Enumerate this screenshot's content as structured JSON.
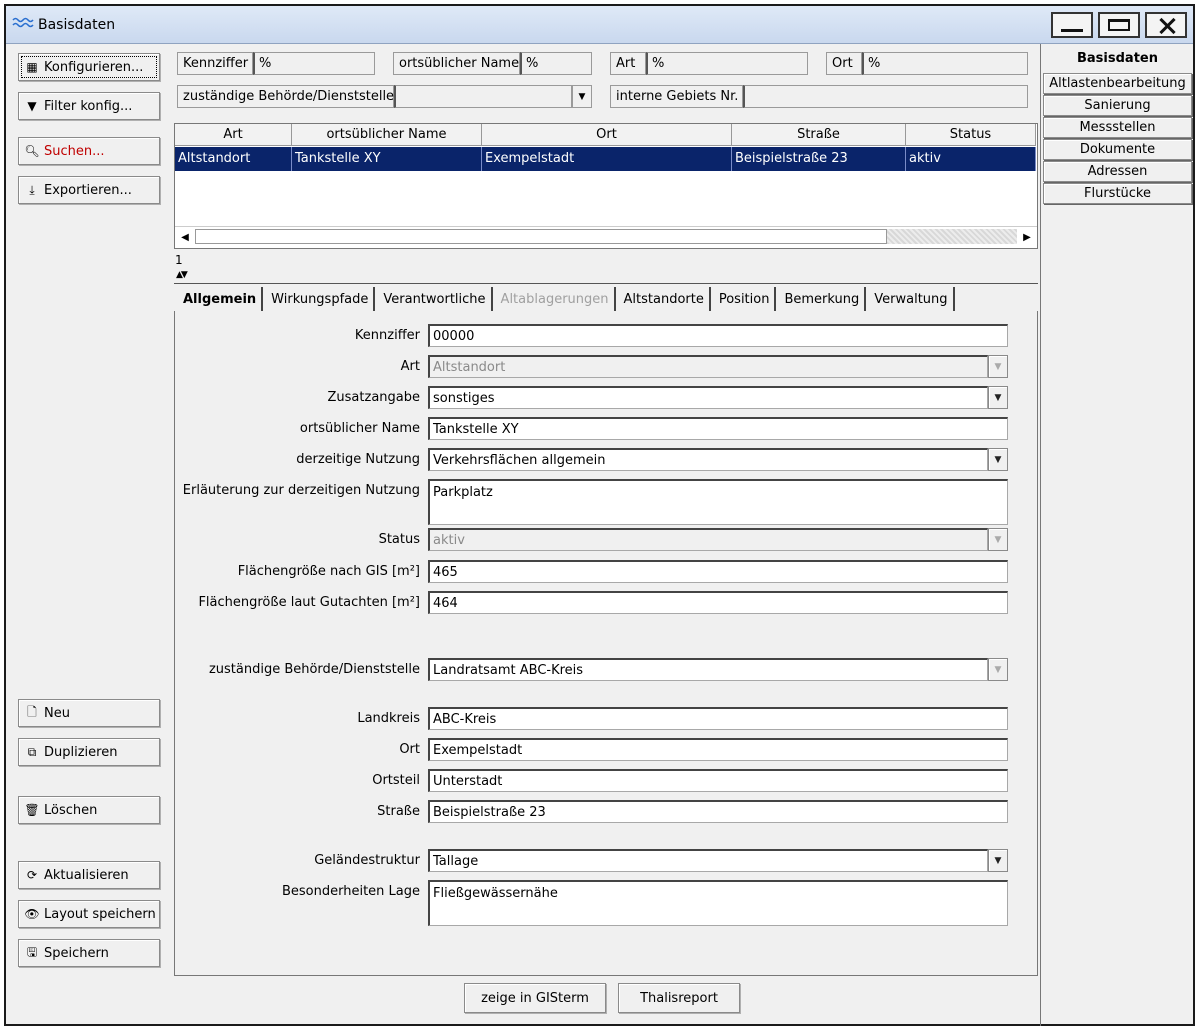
{
  "window": {
    "title": "Basisdaten"
  },
  "left_buttons": {
    "configure": "Konfigurieren...",
    "filter": "Filter konfig...",
    "search": "Suchen...",
    "export": "Exportieren...",
    "new": "Neu",
    "duplicate": "Duplizieren",
    "delete": "Löschen",
    "refresh": "Aktualisieren",
    "save_layout": "Layout speichern",
    "save": "Speichern"
  },
  "filters": {
    "kennziffer_label": "Kennziffer",
    "kennziffer_value": "%",
    "name_label": "ortsüblicher Name",
    "name_value": "%",
    "art_label": "Art",
    "art_value": "%",
    "ort_label": "Ort",
    "ort_value": "%",
    "behoerde_label": "zuständige Behörde/Dienststelle",
    "behoerde_value": "",
    "gebiet_label": "interne Gebiets Nr.",
    "gebiet_value": ""
  },
  "grid": {
    "columns": [
      "Art",
      "ortsüblicher Name",
      "Ort",
      "Straße",
      "Status"
    ],
    "rows": [
      [
        "Altstandort",
        "Tankstelle XY",
        "Exempelstadt",
        "Beispielstraße 23",
        "aktiv"
      ]
    ],
    "count": "1"
  },
  "tabs": [
    "Allgemein",
    "Wirkungspfade",
    "Verantwortliche",
    "Altablagerungen",
    "Altstandorte",
    "Position",
    "Bemerkung",
    "Verwaltung"
  ],
  "form": {
    "kennziffer": {
      "label": "Kennziffer",
      "value": "00000"
    },
    "art": {
      "label": "Art",
      "value": "Altstandort"
    },
    "zusatz": {
      "label": "Zusatzangabe",
      "value": "sonstiges"
    },
    "name": {
      "label": "ortsüblicher Name",
      "value": "Tankstelle XY"
    },
    "nutzung": {
      "label": "derzeitige Nutzung",
      "value": "Verkehrsflächen allgemein"
    },
    "erlaeuterung": {
      "label": "Erläuterung zur derzeitigen Nutzung",
      "value": "Parkplatz"
    },
    "status": {
      "label": "Status",
      "value": "aktiv"
    },
    "flaeche_gis": {
      "label": "Flächengröße nach GIS [m²]",
      "value": "465"
    },
    "flaeche_gutachten": {
      "label": "Flächengröße laut Gutachten [m²]",
      "value": "464"
    },
    "behoerde": {
      "label": "zuständige Behörde/Dienststelle",
      "value": "Landratsamt ABC-Kreis"
    },
    "landkreis": {
      "label": "Landkreis",
      "value": "ABC-Kreis"
    },
    "ort": {
      "label": "Ort",
      "value": "Exempelstadt"
    },
    "ortsteil": {
      "label": "Ortsteil",
      "value": "Unterstadt"
    },
    "strasse": {
      "label": "Straße",
      "value": "Beispielstraße 23"
    },
    "gelaende": {
      "label": "Geländestruktur",
      "value": "Tallage"
    },
    "besonderheiten": {
      "label": "Besonderheiten Lage",
      "value": "Fließgewässernähe"
    }
  },
  "bottom_buttons": {
    "gis": "zeige in GISterm",
    "report": "Thalisreport"
  },
  "right_tabs": [
    "Basisdaten",
    "Altlastenbearbeitung",
    "Sanierung",
    "Messstellen",
    "Dokumente",
    "Adressen",
    "Flurstücke"
  ]
}
